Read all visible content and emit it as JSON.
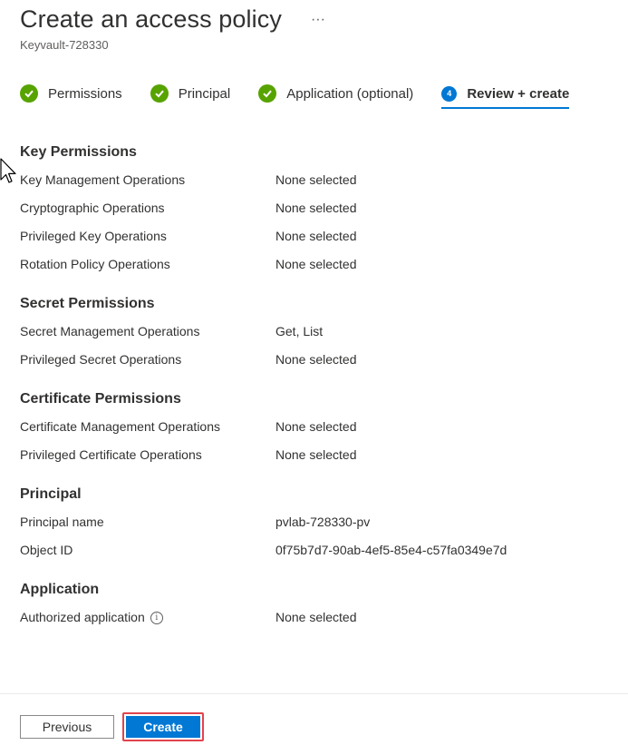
{
  "header": {
    "title": "Create an access policy",
    "more_label": "···",
    "subtitle": "Keyvault-728330"
  },
  "steps": [
    {
      "label": "Permissions",
      "state": "complete"
    },
    {
      "label": "Principal",
      "state": "complete"
    },
    {
      "label": "Application (optional)",
      "state": "complete"
    },
    {
      "label": "Review + create",
      "number": "4",
      "state": "active"
    }
  ],
  "sections": {
    "key": {
      "title": "Key Permissions",
      "rows": [
        {
          "key": "Key Management Operations",
          "value": "None selected"
        },
        {
          "key": "Cryptographic Operations",
          "value": "None selected"
        },
        {
          "key": "Privileged Key Operations",
          "value": "None selected"
        },
        {
          "key": "Rotation Policy Operations",
          "value": "None selected"
        }
      ]
    },
    "secret": {
      "title": "Secret Permissions",
      "rows": [
        {
          "key": "Secret Management Operations",
          "value": "Get, List"
        },
        {
          "key": "Privileged Secret Operations",
          "value": "None selected"
        }
      ]
    },
    "certificate": {
      "title": "Certificate Permissions",
      "rows": [
        {
          "key": "Certificate Management Operations",
          "value": "None selected"
        },
        {
          "key": "Privileged Certificate Operations",
          "value": "None selected"
        }
      ]
    },
    "principal": {
      "title": "Principal",
      "rows": [
        {
          "key": "Principal name",
          "value": "pvlab-728330-pv"
        },
        {
          "key": "Object ID",
          "value": "0f75b7d7-90ab-4ef5-85e4-c57fa0349e7d"
        }
      ]
    },
    "application": {
      "title": "Application",
      "rows": [
        {
          "key": "Authorized application",
          "value": "None selected",
          "info_icon": "i"
        }
      ]
    }
  },
  "footer": {
    "previous_label": "Previous",
    "create_label": "Create"
  },
  "colors": {
    "accent": "#0078d4",
    "success": "#57a300",
    "highlight": "#e0444e"
  },
  "icons": [
    "check-circle-icon",
    "step-number-icon",
    "info-icon",
    "more-icon",
    "mouse-cursor-icon"
  ]
}
